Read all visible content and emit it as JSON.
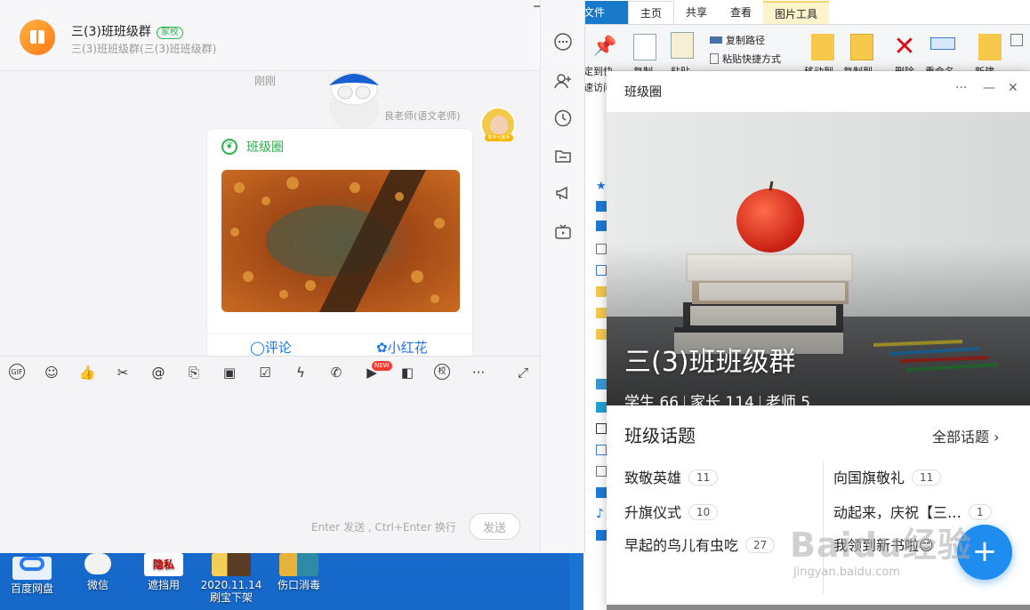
{
  "desktop": {
    "icons": [
      {
        "label": "百度网盘",
        "color": "#e8f1fb"
      },
      {
        "label": "微信",
        "color": "#2dc100"
      },
      {
        "label": "遮挡用",
        "color": "#ffffff"
      },
      {
        "label": "2020.11.14\n刷宝下架",
        "color": "#6b4a2a"
      },
      {
        "label": "伤口消毒",
        "color": "#e5b23a"
      }
    ]
  },
  "explorer": {
    "tabs": [
      "文件",
      "主页",
      "共享",
      "查看",
      "图片工具"
    ],
    "copy_path": "复制路径",
    "paste_shortcut": "粘贴快捷方式",
    "btn_pin": "定到快",
    "btn_access": "速访问",
    "btn_copy": "复制",
    "btn_paste": "粘贴",
    "btn_move": "移动到",
    "btn_copyto": "复制到",
    "btn_delete": "删除",
    "btn_rename": "重命名",
    "btn_new": "新建"
  },
  "chat": {
    "group_name": "三(3)班班级群",
    "group_badge": "家校",
    "group_sub": "三(3)班班级群(三(3)班班级群)",
    "timestamp": "刚刚",
    "sender": "良老师(语文老师)",
    "sender_badge": "数字化教师",
    "card": {
      "title": "班级圈",
      "comment_label": "评论",
      "flower_label": "小红花"
    },
    "toolbar": {
      "gif": "GIF",
      "new_badge": "NEW",
      "school": "校",
      "more": "···"
    },
    "composer": {
      "hint": "Enter 发送 , Ctrl+Enter 换行",
      "send": "发送"
    }
  },
  "circle_window": {
    "title": "班级圈",
    "hero_title": "三(3)班班级群",
    "stats": {
      "students": "学生 66",
      "parents": "家长 114",
      "teachers": "老师 5"
    },
    "topics_header": "班级话题",
    "all_topics": "全部话题",
    "topics": [
      {
        "name": "致敬英雄",
        "count": "11"
      },
      {
        "name": "向国旗敬礼",
        "count": "11"
      },
      {
        "name": "升旗仪式",
        "count": "10"
      },
      {
        "name": "动起来，庆祝【三…",
        "count": "1"
      },
      {
        "name": "早起的鸟儿有虫吃",
        "count": "27"
      },
      {
        "name": "我领到新书啦😊",
        "count": ""
      }
    ],
    "fab": "+"
  },
  "watermark": {
    "text": "Baidu经验",
    "url": "jingyan.baidu.com"
  }
}
